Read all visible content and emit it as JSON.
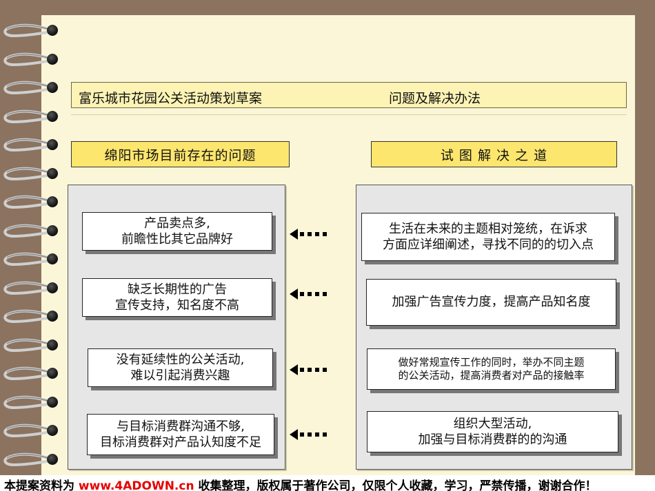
{
  "header": {
    "left": "富乐城市花园公关活动策划草案",
    "right": "问题及解决办法"
  },
  "left_title": "绵阳市场目前存在的问题",
  "right_title": "试 图 解 决 之 道",
  "problems": [
    {
      "l1": "产品卖点多,",
      "l2": "前瞻性比其它品牌好"
    },
    {
      "l1": "缺乏长期性的广告",
      "l2": "宣传支持，知名度不高"
    },
    {
      "l1": "没有延续性的公关活动,",
      "l2": "难以引起消费兴趣"
    },
    {
      "l1": "与目标消费群沟通不够,",
      "l2": "目标消费群对产品认知度不足"
    }
  ],
  "solutions": [
    {
      "l1": "生活在未来的主题相对笼统，在诉求",
      "l2": "方面应详细阐述，寻找不同的的切入点"
    },
    {
      "l1": "加强广告宣传力度，提高产品知名度",
      "l2": ""
    },
    {
      "l1": "做好常规宣传工作的同时，举办不同主题",
      "l2": "的公关活动，提高消费者对产品的接触率"
    },
    {
      "l1": "组织大型活动,",
      "l2": "加强与目标消费群的的沟通"
    }
  ],
  "footer": {
    "before": "本提案资料为 ",
    "brand": "www.4ADOWN.cn",
    "after": " 收集整理，版权属于著作公司，仅限个人收藏，学习，严禁传播，谢谢合作！"
  },
  "colors": {
    "background": "#8b7360",
    "paper": "#fbf6d8",
    "title_fill": "#fde66e",
    "brand": "#e60000"
  },
  "icons": [
    "spiral-ring-icon",
    "punch-hole-icon",
    "dotted-arrow-left-icon"
  ]
}
